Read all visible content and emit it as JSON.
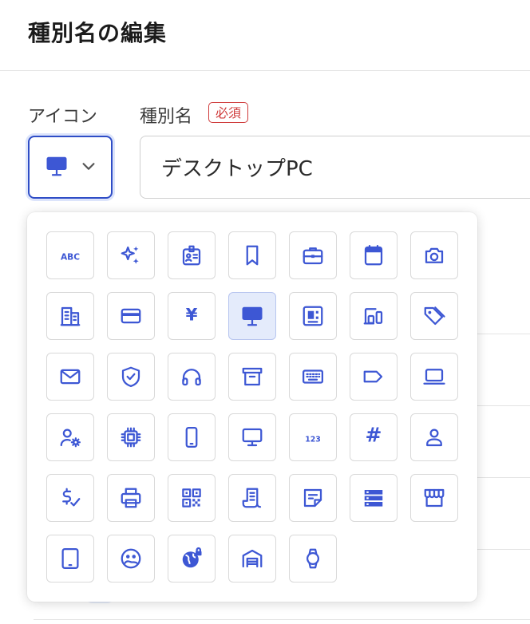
{
  "header": {
    "title": "種別名の編集"
  },
  "form": {
    "icon_label": "アイコン",
    "name_label": "種別名",
    "required_badge": "必須",
    "selected_icon": "desktop-icon",
    "name_value": "デスクトップPC"
  },
  "colors": {
    "accent": "#3d57d4",
    "selected_bg": "#e4ebfb",
    "required": "#cf3b3b",
    "tile_border": "#d9d9d9"
  },
  "icon_picker": {
    "selected": "desktop-icon",
    "icons": [
      {
        "name": "abc-text-icon",
        "text": "ABC"
      },
      {
        "name": "sparkles-icon"
      },
      {
        "name": "id-badge-icon"
      },
      {
        "name": "bookmark-icon"
      },
      {
        "name": "briefcase-icon"
      },
      {
        "name": "calendar-icon"
      },
      {
        "name": "camera-icon"
      },
      {
        "name": "building-icon"
      },
      {
        "name": "credit-card-icon"
      },
      {
        "name": "yen-icon",
        "text": "¥"
      },
      {
        "name": "desktop-icon"
      },
      {
        "name": "circuit-board-icon"
      },
      {
        "name": "devices-icon"
      },
      {
        "name": "tags-icon"
      },
      {
        "name": "mail-icon"
      },
      {
        "name": "shield-check-icon"
      },
      {
        "name": "headphones-icon"
      },
      {
        "name": "archive-box-icon"
      },
      {
        "name": "keyboard-icon"
      },
      {
        "name": "label-tag-icon"
      },
      {
        "name": "laptop-icon"
      },
      {
        "name": "user-cog-icon"
      },
      {
        "name": "cpu-chip-icon"
      },
      {
        "name": "smartphone-icon"
      },
      {
        "name": "monitor-icon"
      },
      {
        "name": "numbers-icon",
        "text": "123"
      },
      {
        "name": "hashtag-icon",
        "text": "#"
      },
      {
        "name": "user-icon"
      },
      {
        "name": "dollar-check-icon"
      },
      {
        "name": "printer-icon"
      },
      {
        "name": "qr-code-icon"
      },
      {
        "name": "receipt-icon"
      },
      {
        "name": "sticky-note-icon"
      },
      {
        "name": "server-list-icon"
      },
      {
        "name": "store-icon"
      },
      {
        "name": "tablet-icon"
      },
      {
        "name": "face-icon"
      },
      {
        "name": "globe-lock-icon"
      },
      {
        "name": "garage-icon"
      },
      {
        "name": "watch-icon"
      }
    ]
  }
}
